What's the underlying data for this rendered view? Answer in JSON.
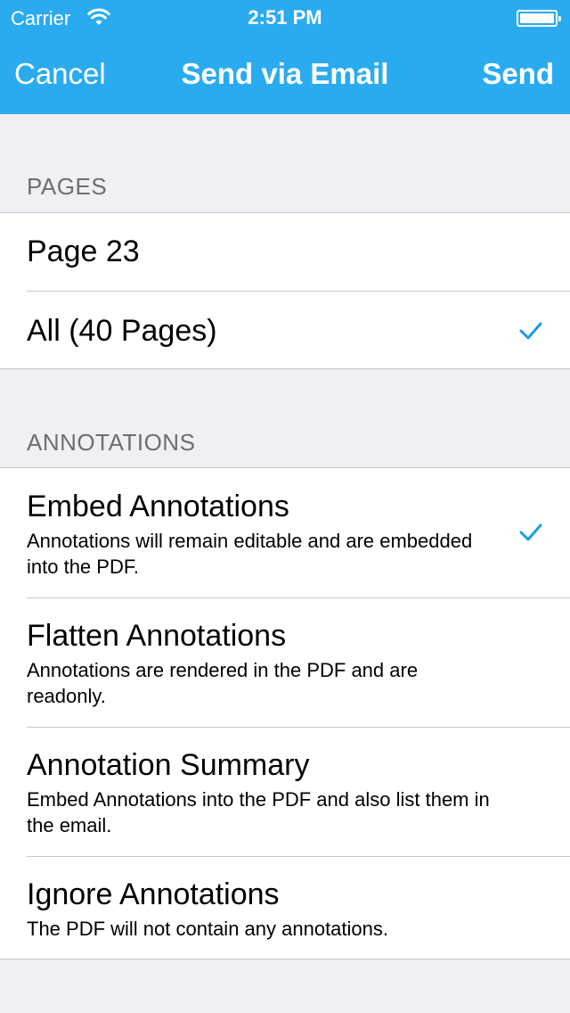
{
  "status_bar": {
    "carrier": "Carrier",
    "time": "2:51 PM"
  },
  "nav_bar": {
    "cancel_label": "Cancel",
    "title": "Send via Email",
    "send_label": "Send"
  },
  "sections": [
    {
      "header": "PAGES",
      "items": [
        {
          "title": "Page 23",
          "checked": false
        },
        {
          "title": "All (40 Pages)",
          "checked": true
        }
      ]
    },
    {
      "header": "ANNOTATIONS",
      "items": [
        {
          "title": "Embed Annotations",
          "subtitle": "Annotations will remain editable and are embedded into the PDF.",
          "checked": true
        },
        {
          "title": "Flatten Annotations",
          "subtitle": "Annotations are rendered in the PDF and are readonly.",
          "checked": false
        },
        {
          "title": "Annotation Summary",
          "subtitle": "Embed Annotations into the PDF and also list them in the email.",
          "checked": false
        },
        {
          "title": "Ignore Annotations",
          "subtitle": "The PDF will not contain any annotations.",
          "checked": false
        }
      ]
    }
  ],
  "colors": {
    "nav_background": "#2aabf0",
    "checkmark": "#1a9bf0",
    "background": "#efeff4"
  }
}
